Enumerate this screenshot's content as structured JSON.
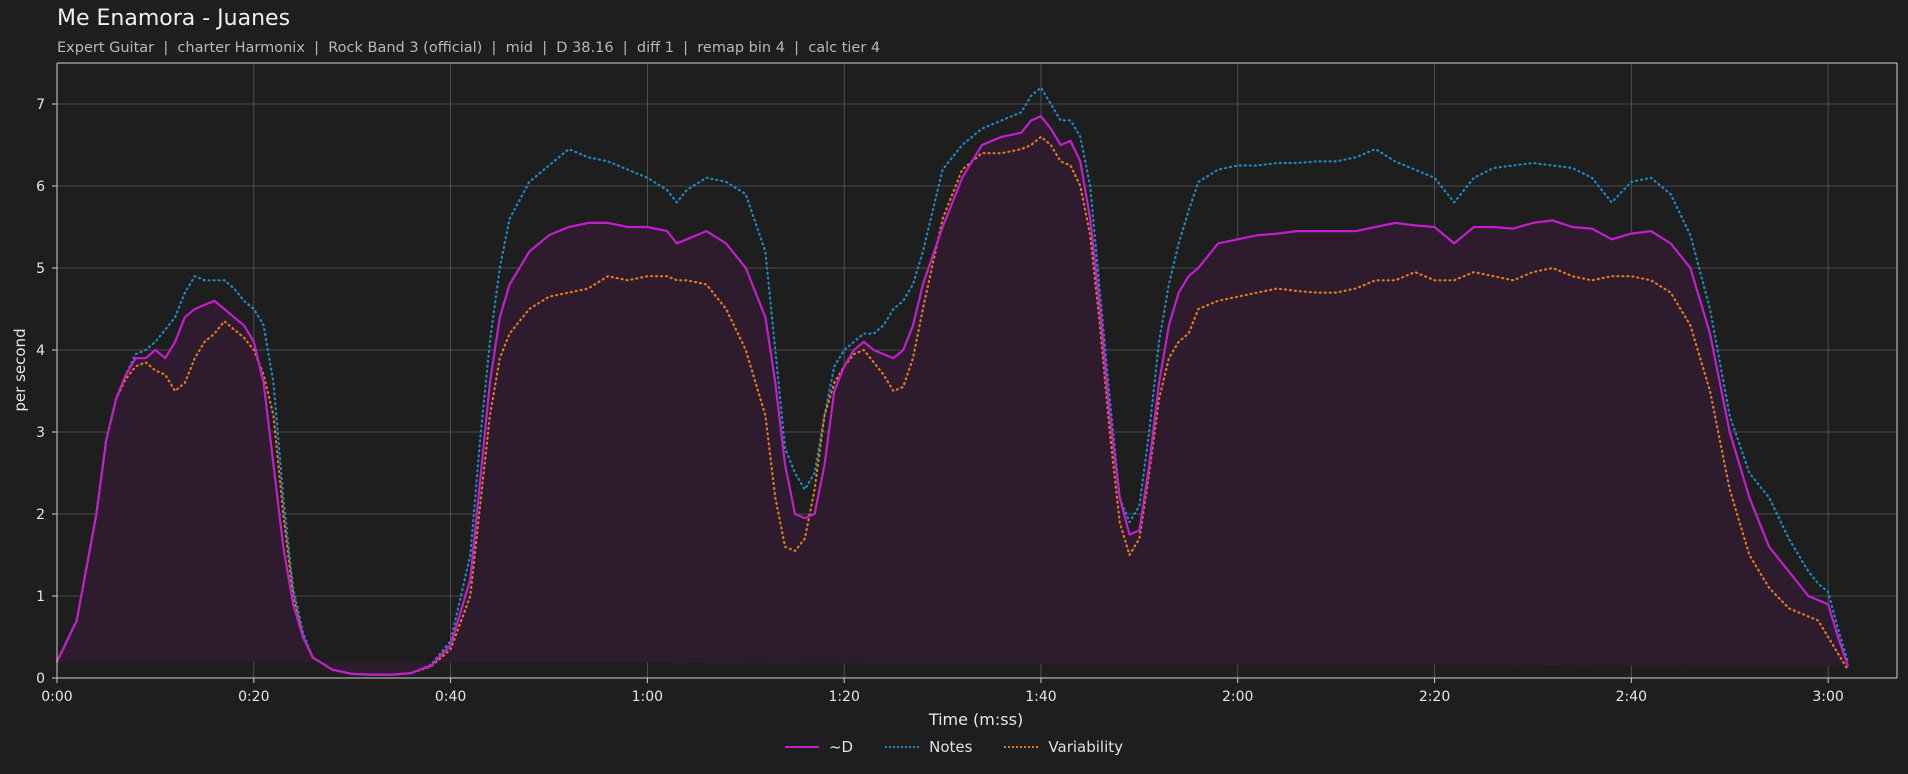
{
  "header": {
    "title": "Me Enamora - Juanes",
    "subtitle": "Expert Guitar  |  charter Harmonix  |  Rock Band 3 (official)  |  mid  |  D 38.16  |  diff 1  |  remap bin 4  |  calc tier 4"
  },
  "colors": {
    "background": "#1e1e1e",
    "plot_background": "#1e1e1e",
    "grid": "#5a5a5a",
    "d": "#c21fcc",
    "notes": "#1f88c4",
    "variability": "#e07a1f",
    "fill": "#2e1b2e"
  },
  "chart_data": {
    "type": "line",
    "xlabel": "Time (m:ss)",
    "ylabel": "per second",
    "xlim": [
      0,
      187
    ],
    "ylim": [
      0,
      7.5
    ],
    "xticks": [
      0,
      20,
      40,
      60,
      80,
      100,
      120,
      140,
      160,
      180
    ],
    "xtick_labels": [
      "0:00",
      "0:20",
      "0:40",
      "1:00",
      "1:20",
      "1:40",
      "2:00",
      "2:20",
      "2:40",
      "3:00"
    ],
    "yticks": [
      0,
      1,
      2,
      3,
      4,
      5,
      6,
      7
    ],
    "ytick_labels": [
      "0",
      "1",
      "2",
      "3",
      "4",
      "5",
      "6",
      "7"
    ],
    "grid": true,
    "legend_position": "bottom-center",
    "x": [
      0,
      2,
      4,
      5,
      6,
      7,
      8,
      9,
      10,
      11,
      12,
      13,
      14,
      15,
      16,
      17,
      18,
      19,
      20,
      21,
      22,
      23,
      24,
      25,
      26,
      28,
      30,
      32,
      34,
      36,
      38,
      40,
      42,
      43,
      44,
      45,
      46,
      48,
      50,
      52,
      54,
      56,
      58,
      60,
      62,
      63,
      64,
      66,
      68,
      70,
      72,
      73,
      74,
      75,
      76,
      77,
      78,
      79,
      80,
      81,
      82,
      83,
      84,
      85,
      86,
      87,
      88,
      90,
      92,
      94,
      96,
      98,
      99,
      100,
      101,
      102,
      103,
      104,
      105,
      106,
      107,
      108,
      109,
      110,
      111,
      112,
      113,
      114,
      115,
      116,
      118,
      120,
      122,
      124,
      126,
      128,
      130,
      132,
      134,
      136,
      138,
      140,
      142,
      144,
      146,
      148,
      150,
      152,
      154,
      156,
      158,
      160,
      162,
      164,
      166,
      168,
      170,
      172,
      174,
      176,
      178,
      179,
      180,
      181,
      182,
      183,
      184,
      185,
      186,
      187
    ],
    "series": [
      {
        "name": "~D",
        "style": "solid",
        "values": [
          0.2,
          0.7,
          2.0,
          2.9,
          3.4,
          3.7,
          3.9,
          3.9,
          4.0,
          3.9,
          4.1,
          4.4,
          4.5,
          4.55,
          4.6,
          4.5,
          4.4,
          4.3,
          4.1,
          3.6,
          2.6,
          1.6,
          0.9,
          0.5,
          0.25,
          0.1,
          0.05,
          0.04,
          0.04,
          0.06,
          0.15,
          0.4,
          1.2,
          2.4,
          3.6,
          4.4,
          4.8,
          5.2,
          5.4,
          5.5,
          5.55,
          5.55,
          5.5,
          5.5,
          5.45,
          5.3,
          5.35,
          5.45,
          5.3,
          5.0,
          4.4,
          3.6,
          2.6,
          2.0,
          1.95,
          2.0,
          2.6,
          3.5,
          3.8,
          4.0,
          4.1,
          4.0,
          3.95,
          3.9,
          4.0,
          4.3,
          4.8,
          5.5,
          6.1,
          6.5,
          6.6,
          6.65,
          6.8,
          6.85,
          6.7,
          6.5,
          6.55,
          6.3,
          5.6,
          4.5,
          3.2,
          2.2,
          1.75,
          1.8,
          2.6,
          3.6,
          4.3,
          4.7,
          4.9,
          5.0,
          5.3,
          5.35,
          5.4,
          5.42,
          5.45,
          5.45,
          5.45,
          5.45,
          5.5,
          5.55,
          5.52,
          5.5,
          5.3,
          5.5,
          5.5,
          5.48,
          5.55,
          5.58,
          5.5,
          5.48,
          5.35,
          5.42,
          5.45,
          5.3,
          5.0,
          4.2,
          3.0,
          2.2,
          1.6,
          1.3,
          1.0,
          0.95,
          0.9,
          0.5,
          0.15
        ]
      },
      {
        "name": "Notes",
        "style": "dotted",
        "values": [
          0.2,
          0.7,
          2.0,
          2.9,
          3.4,
          3.7,
          3.95,
          4.0,
          4.1,
          4.25,
          4.4,
          4.7,
          4.9,
          4.85,
          4.85,
          4.85,
          4.75,
          4.6,
          4.5,
          4.3,
          3.6,
          2.2,
          1.1,
          0.55,
          0.25,
          0.1,
          0.05,
          0.04,
          0.04,
          0.06,
          0.16,
          0.45,
          1.5,
          2.9,
          4.1,
          5.0,
          5.6,
          6.05,
          6.25,
          6.45,
          6.35,
          6.3,
          6.2,
          6.1,
          5.95,
          5.8,
          5.95,
          6.1,
          6.05,
          5.9,
          5.2,
          4.0,
          2.8,
          2.5,
          2.3,
          2.5,
          3.2,
          3.8,
          4.0,
          4.1,
          4.2,
          4.2,
          4.3,
          4.5,
          4.6,
          4.8,
          5.2,
          6.2,
          6.5,
          6.7,
          6.8,
          6.9,
          7.1,
          7.2,
          7.0,
          6.8,
          6.8,
          6.6,
          6.0,
          4.7,
          3.4,
          2.2,
          1.9,
          2.1,
          3.0,
          4.1,
          4.8,
          5.3,
          5.7,
          6.05,
          6.2,
          6.25,
          6.25,
          6.28,
          6.28,
          6.3,
          6.3,
          6.35,
          6.45,
          6.3,
          6.2,
          6.1,
          5.8,
          6.1,
          6.22,
          6.25,
          6.28,
          6.25,
          6.22,
          6.1,
          5.8,
          6.05,
          6.1,
          5.9,
          5.4,
          4.5,
          3.2,
          2.5,
          2.2,
          1.7,
          1.3,
          1.15,
          1.05,
          0.6,
          0.2
        ]
      },
      {
        "name": "Variability",
        "style": "dotted",
        "values": [
          0.2,
          0.7,
          2.0,
          2.9,
          3.4,
          3.65,
          3.8,
          3.85,
          3.75,
          3.7,
          3.5,
          3.6,
          3.9,
          4.1,
          4.2,
          4.35,
          4.25,
          4.15,
          4.0,
          3.7,
          3.2,
          2.0,
          1.0,
          0.5,
          0.25,
          0.1,
          0.05,
          0.04,
          0.04,
          0.06,
          0.14,
          0.35,
          1.0,
          2.1,
          3.2,
          3.9,
          4.2,
          4.5,
          4.65,
          4.7,
          4.75,
          4.9,
          4.85,
          4.9,
          4.9,
          4.85,
          4.85,
          4.8,
          4.5,
          4.0,
          3.2,
          2.2,
          1.6,
          1.55,
          1.7,
          2.3,
          3.2,
          3.6,
          3.8,
          3.95,
          4.0,
          3.85,
          3.7,
          3.5,
          3.55,
          3.9,
          4.5,
          5.6,
          6.2,
          6.4,
          6.4,
          6.45,
          6.5,
          6.6,
          6.5,
          6.3,
          6.25,
          6.0,
          5.4,
          4.3,
          3.0,
          1.9,
          1.5,
          1.7,
          2.5,
          3.4,
          3.9,
          4.1,
          4.2,
          4.5,
          4.6,
          4.65,
          4.7,
          4.75,
          4.72,
          4.7,
          4.7,
          4.75,
          4.85,
          4.85,
          4.95,
          4.85,
          4.85,
          4.95,
          4.9,
          4.85,
          4.95,
          5.0,
          4.9,
          4.85,
          4.9,
          4.9,
          4.85,
          4.7,
          4.3,
          3.5,
          2.3,
          1.5,
          1.1,
          0.85,
          0.75,
          0.7,
          0.5,
          0.3,
          0.1
        ]
      }
    ]
  }
}
